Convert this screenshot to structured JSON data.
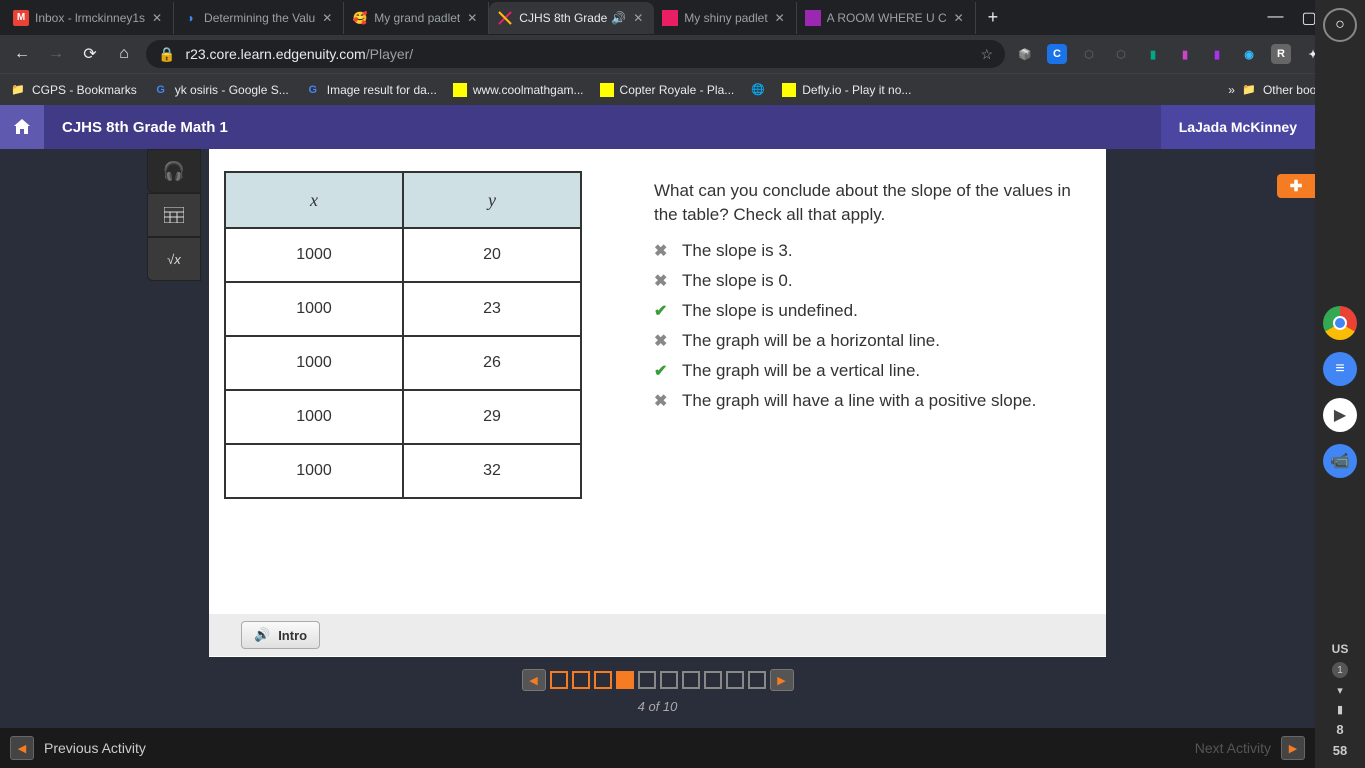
{
  "browser": {
    "tabs": [
      {
        "favicon": "M",
        "favicon_bg": "#ea4335",
        "title": "Inbox - lrmckinney1s"
      },
      {
        "favicon": "◑",
        "favicon_bg": "#4285f4",
        "title": "Determining the Valu"
      },
      {
        "favicon": "🥰",
        "favicon_bg": "",
        "title": "My grand padlet"
      },
      {
        "favicon": "✖",
        "favicon_bg": "#fff",
        "title": "CJHS 8th Grade",
        "active": true,
        "audio": true
      },
      {
        "favicon": "▪",
        "favicon_bg": "#e91e63",
        "title": "My shiny padlet"
      },
      {
        "favicon": "▪",
        "favicon_bg": "#9c27b0",
        "title": "A ROOM WHERE U C"
      }
    ],
    "url_host": "r23.core.learn.edgenuity.com",
    "url_path": "/Player/",
    "bookmarks": [
      {
        "icon": "📁",
        "label": "CGPS - Bookmarks"
      },
      {
        "icon": "G",
        "label": "yk osiris - Google S..."
      },
      {
        "icon": "G",
        "label": "Image result for da..."
      },
      {
        "icon": "▪",
        "label": "www.coolmathgam..."
      },
      {
        "icon": "▪",
        "label": "Copter Royale - Pla..."
      },
      {
        "icon": "🌐",
        "label": ""
      },
      {
        "icon": "▪",
        "label": "Defly.io - Play it no..."
      }
    ],
    "other_bookmarks": "Other bookmarks",
    "overflow": "»"
  },
  "page": {
    "course_title": "CJHS 8th Grade Math 1",
    "user_name": "LaJada McKinney",
    "table": {
      "headers": [
        "x",
        "y"
      ],
      "rows": [
        [
          "1000",
          "20"
        ],
        [
          "1000",
          "23"
        ],
        [
          "1000",
          "26"
        ],
        [
          "1000",
          "29"
        ],
        [
          "1000",
          "32"
        ]
      ]
    },
    "question": "What can you conclude about the slope of the values in the table? Check all that apply.",
    "answers": [
      {
        "mark": "x",
        "text": "The slope is 3."
      },
      {
        "mark": "x",
        "text": "The slope is 0."
      },
      {
        "mark": "check",
        "text": "The slope is undefined."
      },
      {
        "mark": "x",
        "text": "The graph will be a horizontal line."
      },
      {
        "mark": "check",
        "text": "The graph will be a vertical line."
      },
      {
        "mark": "x",
        "text": "The graph will have a line with a positive slope."
      }
    ],
    "intro_label": "Intro",
    "pager": {
      "current": 4,
      "total": 10,
      "label": "4 of 10"
    },
    "prev_activity": "Previous Activity",
    "next_activity": "Next Activity"
  },
  "system": {
    "lang": "US",
    "notif": "1",
    "time1": "8",
    "time2": "58"
  }
}
